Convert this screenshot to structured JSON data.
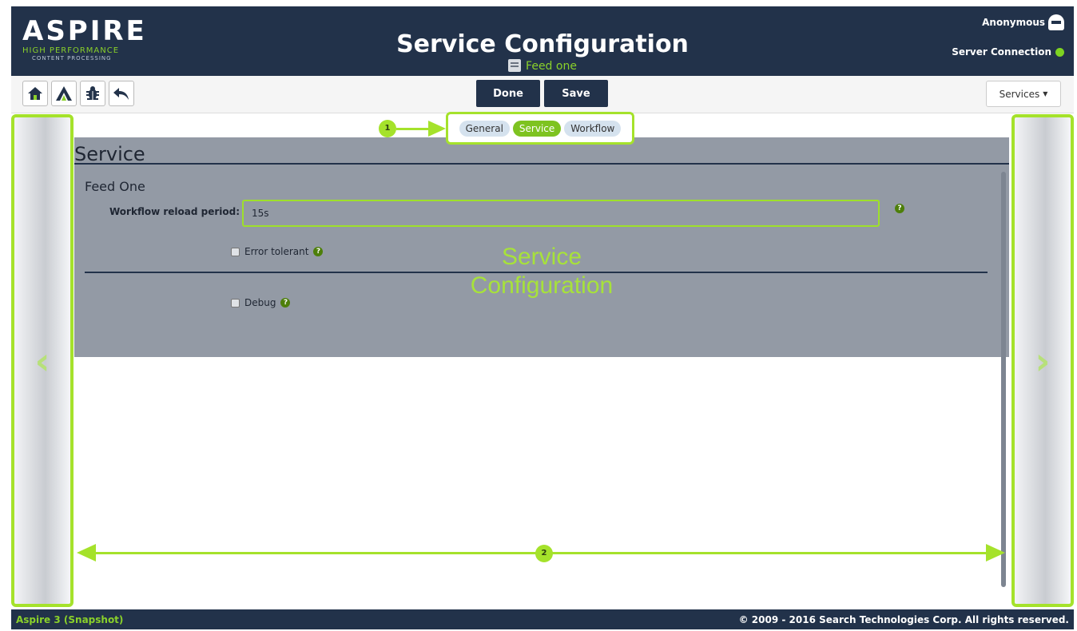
{
  "header": {
    "logo": {
      "title": "ASPIRE",
      "subtitle1": "HIGH PERFORMANCE",
      "subtitle2": "CONTENT PROCESSING"
    },
    "title": "Service Configuration",
    "subtitle": "Feed one",
    "user": "Anonymous",
    "server_connection": "Server Connection",
    "status_color": "#7ed321"
  },
  "toolbar": {
    "icons": [
      "home-icon",
      "aspire-logo-icon",
      "bug-icon",
      "undo-icon"
    ],
    "done_label": "Done",
    "save_label": "Save",
    "services_label": "Services"
  },
  "tabs": [
    {
      "label": "General",
      "active": false
    },
    {
      "label": "Service",
      "active": true
    },
    {
      "label": "Workflow",
      "active": false
    }
  ],
  "panel": {
    "title": "Service",
    "section_title": "Feed One",
    "workflow_reload_label": "Workflow reload period:",
    "workflow_reload_value": "15s",
    "error_tolerant_label": "Error tolerant",
    "debug_label": "Debug",
    "overlay_text_1": "Service",
    "overlay_text_2": "Configuration"
  },
  "annotations": {
    "badge1": "1",
    "badge2": "2"
  },
  "footer": {
    "left": "Aspire 3 (Snapshot)",
    "right": "© 2009 - 2016 Search Technologies Corp. All rights reserved."
  },
  "colors": {
    "navy": "#22324a",
    "accent_green": "#a5e22b",
    "brand_green": "#8ad12a"
  }
}
